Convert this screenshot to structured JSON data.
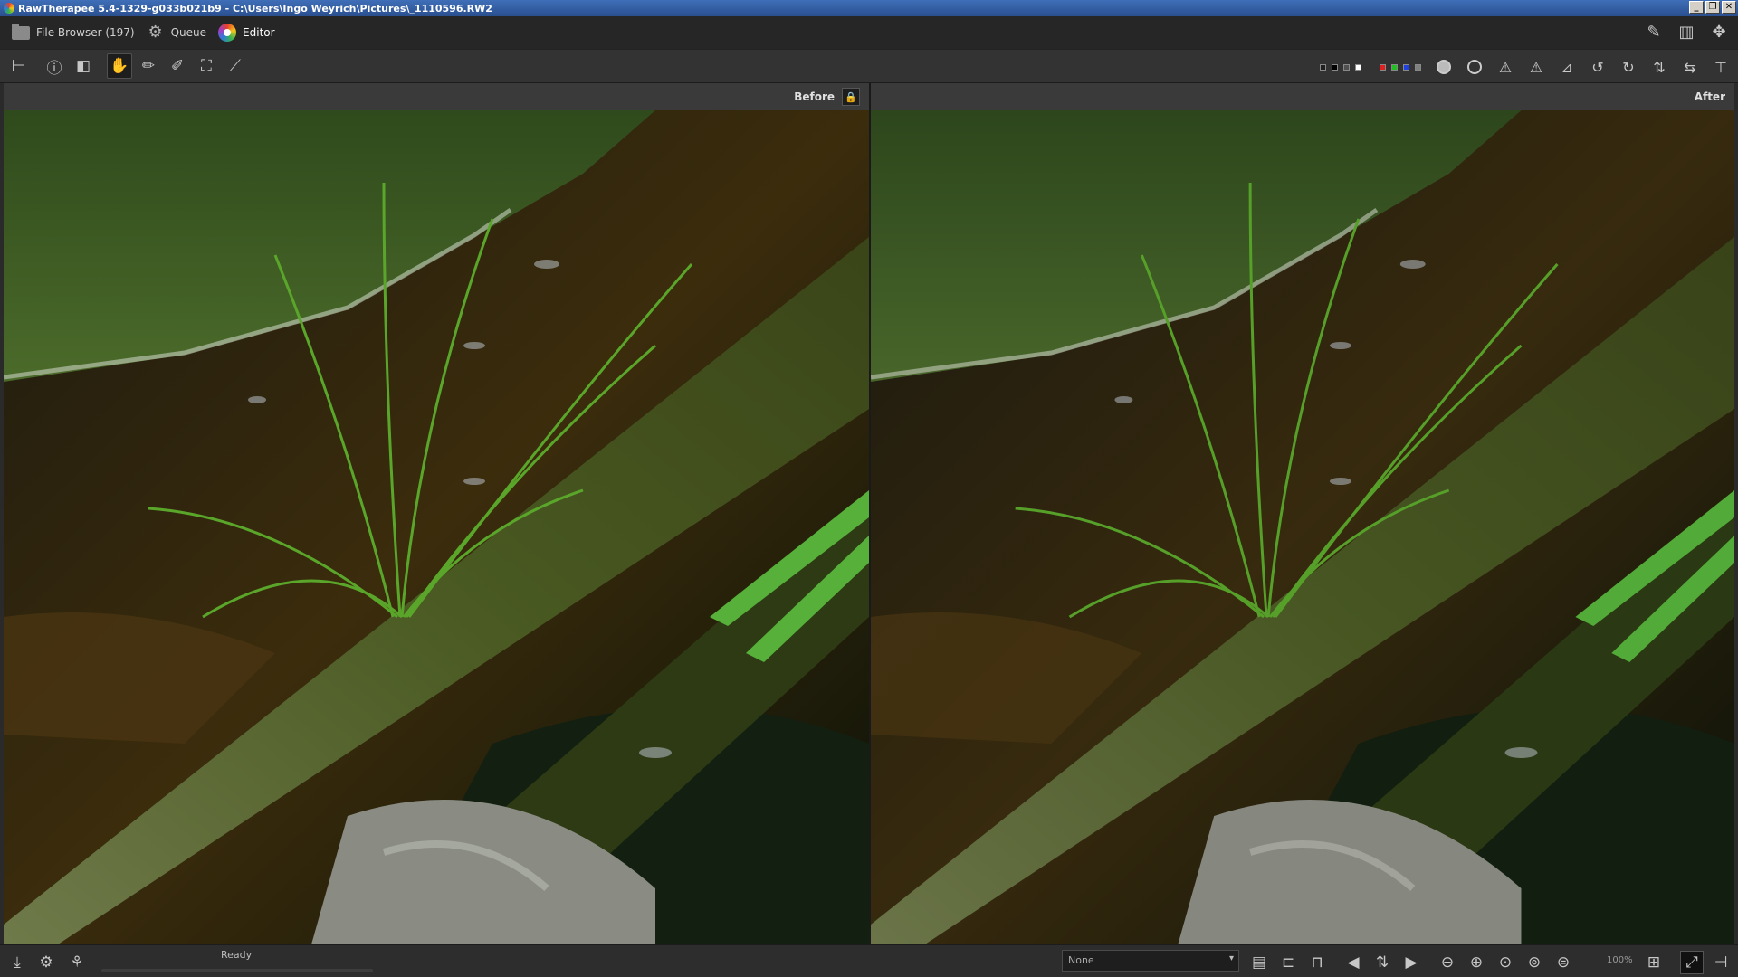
{
  "window": {
    "title": "RawTherapee 5.4-1329-g033b021b9 - C:\\Users\\Ingo Weyrich\\Pictures\\_1110596.RW2",
    "buttons": [
      "minimize",
      "restore",
      "close"
    ]
  },
  "tabs": [
    {
      "label": "File Browser (197)",
      "icon": "folder-icon"
    },
    {
      "label": "Queue",
      "icon": "gears-icon"
    },
    {
      "label": "Editor",
      "icon": "color-wheel-icon",
      "active": true
    }
  ],
  "toolbar": {
    "left_tools": [
      "hide-panel-icon",
      "info-icon",
      "before-after-icon",
      "hand-icon",
      "wb-picker-icon",
      "color-picker-icon",
      "crop-icon",
      "straighten-icon"
    ],
    "active_tool": "hand-icon",
    "swatches": [
      "#202020",
      "#505050",
      "#ffffff",
      "#e02020",
      "#20c020",
      "#2040e0",
      "#808080"
    ],
    "right_tools": [
      "focus-mask-icon",
      "shadow-clip-icon",
      "highlight-warn-icon",
      "shadow-warn-icon",
      "histogram-icon",
      "rotate-left-icon",
      "rotate-right-icon",
      "flip-vertical-icon",
      "flip-horizontal-icon",
      "pin-icon"
    ]
  },
  "before": {
    "label": "Before"
  },
  "after": {
    "label": "After"
  },
  "status": {
    "text": "Ready",
    "profile_select": "None",
    "zoom_level": "100%"
  },
  "colors": {
    "titlebar": "#2a4f8f",
    "background": "#2a2a2a",
    "panel": "#333333"
  }
}
